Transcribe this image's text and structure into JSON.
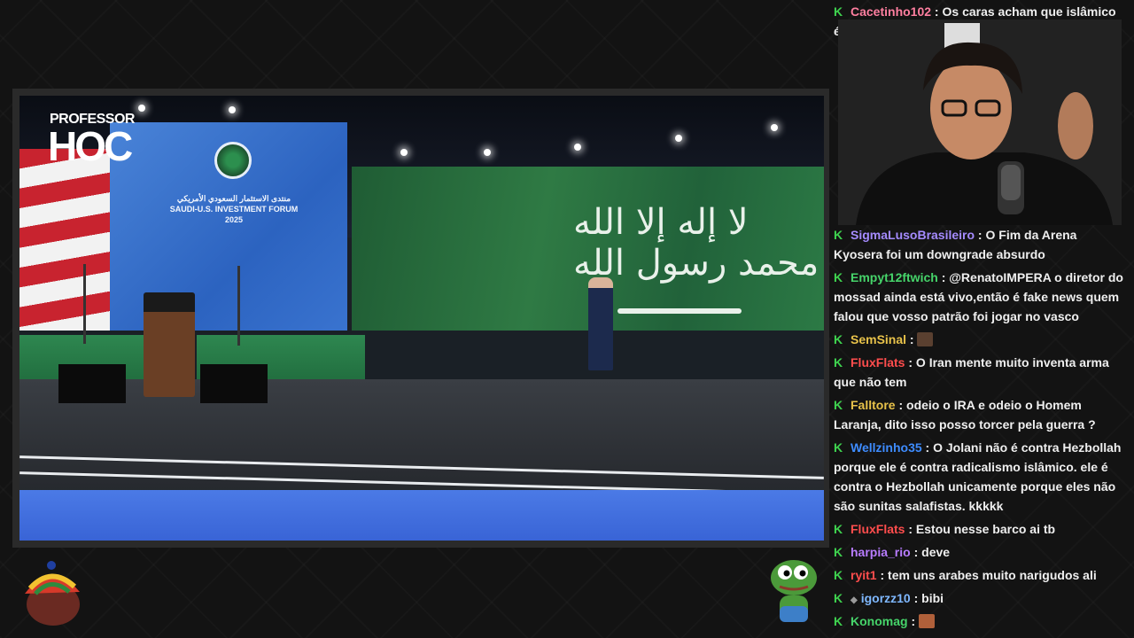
{
  "overlay": {
    "brand_top": "PROFESSOR",
    "brand_main": "HOC"
  },
  "video": {
    "forum_screen_lines": [
      "منتدى الاستثمار السعودي الأمريكي",
      "SAUDI-U.S. INVESTMENT FORUM",
      "2025"
    ],
    "flag_script": "لا إله إلا الله محمد رسول الله"
  },
  "chat": {
    "messages": [
      {
        "user": "Cacetinho102",
        "color": "#ff7fa0",
        "text": "Os caras acham que islâmico é"
      },
      {
        "user": "SigmaLusoBrasileiro",
        "color": "#a58bff",
        "text": "O Fim da Arena Kyosera foi um downgrade absurdo"
      },
      {
        "user": "Empyt12ftwich",
        "color": "#46d46a",
        "text": "@RenatoIMPERA o diretor do mossad ainda está vivo,então é fake news quem falou que vosso patrão foi jogar no vasco"
      },
      {
        "user": "SemSinal",
        "color": "#e8c24a",
        "text": ""
      },
      {
        "user": "FluxFlats",
        "color": "#ff4d4d",
        "text": "O Iran mente muito inventa arma que não tem"
      },
      {
        "user": "Falltore",
        "color": "#e8c24a",
        "text": "odeio o IRA e odeio o Homem Laranja, dito isso posso torcer pela guerra ?"
      },
      {
        "user": "Wellzinho35",
        "color": "#3e8cff",
        "text": "O Jolani não é contra Hezbollah porque ele é contra radicalismo islâmico. ele é contra o Hezbollah unicamente porque eles não são sunitas salafistas. kkkkk"
      },
      {
        "user": "FluxFlats",
        "color": "#ff4d4d",
        "text": "Estou nesse barco ai tb"
      },
      {
        "user": "harpia_rio",
        "color": "#b87cff",
        "text": "deve"
      },
      {
        "user": "ryit1",
        "color": "#ff4d4d",
        "text": "tem uns arabes muito narigudos ali"
      },
      {
        "user": "igorzz10",
        "color": "#7fb8ff",
        "text": "bibi"
      },
      {
        "user": "Konomag",
        "color": "#46d46a",
        "text": ""
      }
    ]
  }
}
